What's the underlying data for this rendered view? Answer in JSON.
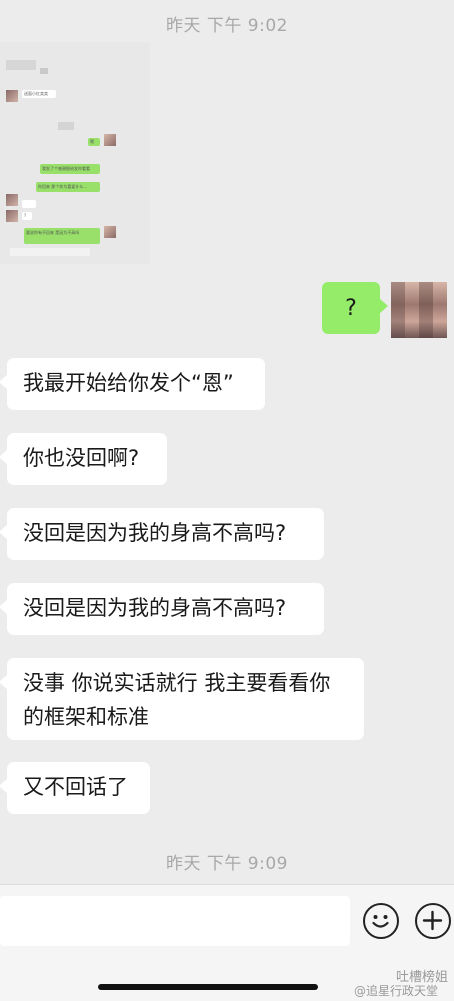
{
  "timestamps": {
    "top": "昨天 下午 9:02",
    "bottom": "昨天 下午 9:09"
  },
  "screenshot_thumbnail": {
    "lines": [
      "送面小红卖卖",
      "我发了个感谢图给发你看看",
      "你回来 那个你为喜爱什么…",
      "嗯",
      "要说你有不回来 是因为不高吗",
      "?"
    ]
  },
  "messages": {
    "sent_1": "?",
    "recv_1": "我最开始给你发个“恩”",
    "recv_2": "你也没回啊?",
    "recv_3": "没回是因为我的身高不高吗?",
    "recv_4": "没回是因为我的身高不高吗?",
    "recv_5_line1": "没事 你说实话就行 我主要看看你",
    "recv_5_line2": "的框架和标准",
    "recv_6": "又不回话了"
  },
  "input": {
    "placeholder": ""
  },
  "icons": {
    "emoji": "emoji-icon",
    "add": "plus-icon"
  },
  "watermark": {
    "line1": "吐槽榜姐",
    "line2": "@追星行政天堂"
  },
  "colors": {
    "sent_bubble": "#95ec69",
    "received_bubble": "#ffffff",
    "background": "#ececec"
  }
}
